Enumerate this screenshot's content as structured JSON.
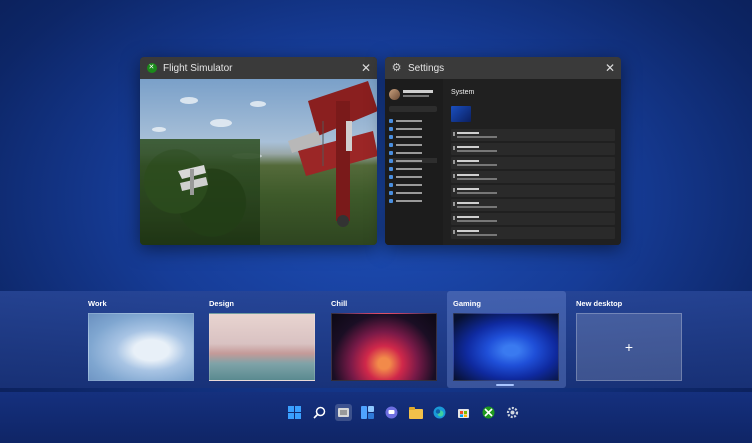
{
  "windows": [
    {
      "title": "Flight Simulator",
      "icon": "xbox-icon",
      "close": "✕"
    },
    {
      "title": "Settings",
      "icon": "gear-icon",
      "close": "✕"
    }
  ],
  "settings_mock": {
    "heading": "System"
  },
  "desktops": [
    {
      "label": "Work",
      "selected": false
    },
    {
      "label": "Design",
      "selected": false
    },
    {
      "label": "Chill",
      "selected": false
    },
    {
      "label": "Gaming",
      "selected": true
    },
    {
      "label": "New desktop",
      "add_symbol": "+"
    }
  ],
  "taskbar": {
    "icons": [
      "windows-start-icon",
      "search-icon",
      "task-view-icon",
      "widgets-icon",
      "teams-chat-icon",
      "file-explorer-icon",
      "edge-icon",
      "store-icon",
      "xbox-icon",
      "settings-gear-icon"
    ],
    "active": "task-view-icon"
  },
  "colors": {
    "accent": "#1e4fb8",
    "taskbar": "#0f2566"
  }
}
